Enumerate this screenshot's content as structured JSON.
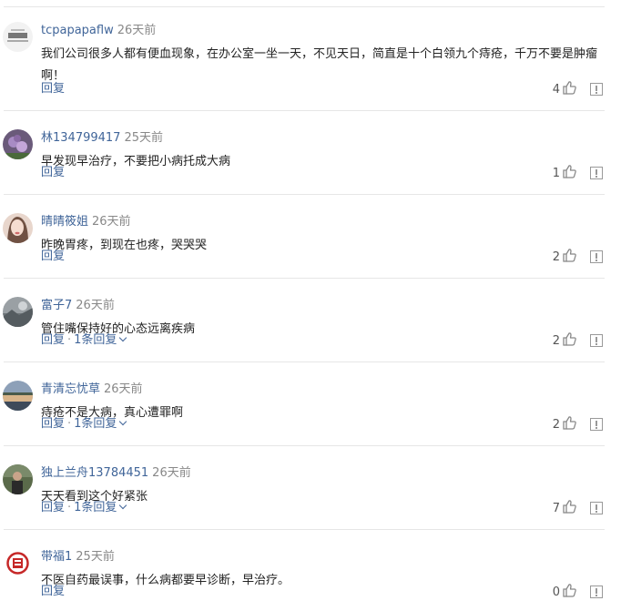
{
  "comments": [
    {
      "username": "tcpapapaflw",
      "time": "26天前",
      "content": "我们公司很多人都有便血现象，在办公室一坐一天，不见天日，简直是十个白领九个痔疮，千万不要是肿瘤啊！",
      "reply_label": "回复",
      "replies_label": "",
      "likes": "4",
      "avatar": "gray-text-avatar"
    },
    {
      "username": "林134799417",
      "time": "25天前",
      "content": "早发现早治疗，不要把小病托成大病",
      "reply_label": "回复",
      "replies_label": "",
      "likes": "1",
      "avatar": "purple-flower-avatar"
    },
    {
      "username": "晴晴筱姐",
      "time": "26天前",
      "content": "昨晚胃疼，到现在也疼，哭哭哭",
      "reply_label": "回复",
      "replies_label": "",
      "likes": "2",
      "avatar": "woman-portrait-avatar"
    },
    {
      "username": "富子7",
      "time": "26天前",
      "content": "管住嘴保持好的心态远离疾病",
      "reply_label": "回复",
      "replies_label": "1条回复",
      "likes": "2",
      "avatar": "gray-landscape-avatar"
    },
    {
      "username": "青清忘忧草",
      "time": "26天前",
      "content": "痔疮不是大病，真心遭罪啊",
      "reply_label": "回复",
      "replies_label": "1条回复",
      "likes": "2",
      "avatar": "lake-sunset-avatar"
    },
    {
      "username": "独上兰舟13784451",
      "time": "26天前",
      "content": "天天看到这个好紧张",
      "reply_label": "回复",
      "replies_label": "1条回复",
      "likes": "7",
      "avatar": "person-outdoor-avatar"
    },
    {
      "username": "带福1",
      "time": "25天前",
      "content": "不医自药最误事，什么病都要早诊断，早治疗。",
      "reply_label": "回复",
      "replies_label": "",
      "likes": "0",
      "avatar": "red-seal-avatar"
    }
  ],
  "icons": {
    "like": "thumbs-up-icon",
    "report": "report-icon",
    "expand": "chevron-down-icon"
  },
  "colors": {
    "link": "#406599",
    "text": "#222222",
    "time": "#888888",
    "divider": "#e6e6e6"
  }
}
